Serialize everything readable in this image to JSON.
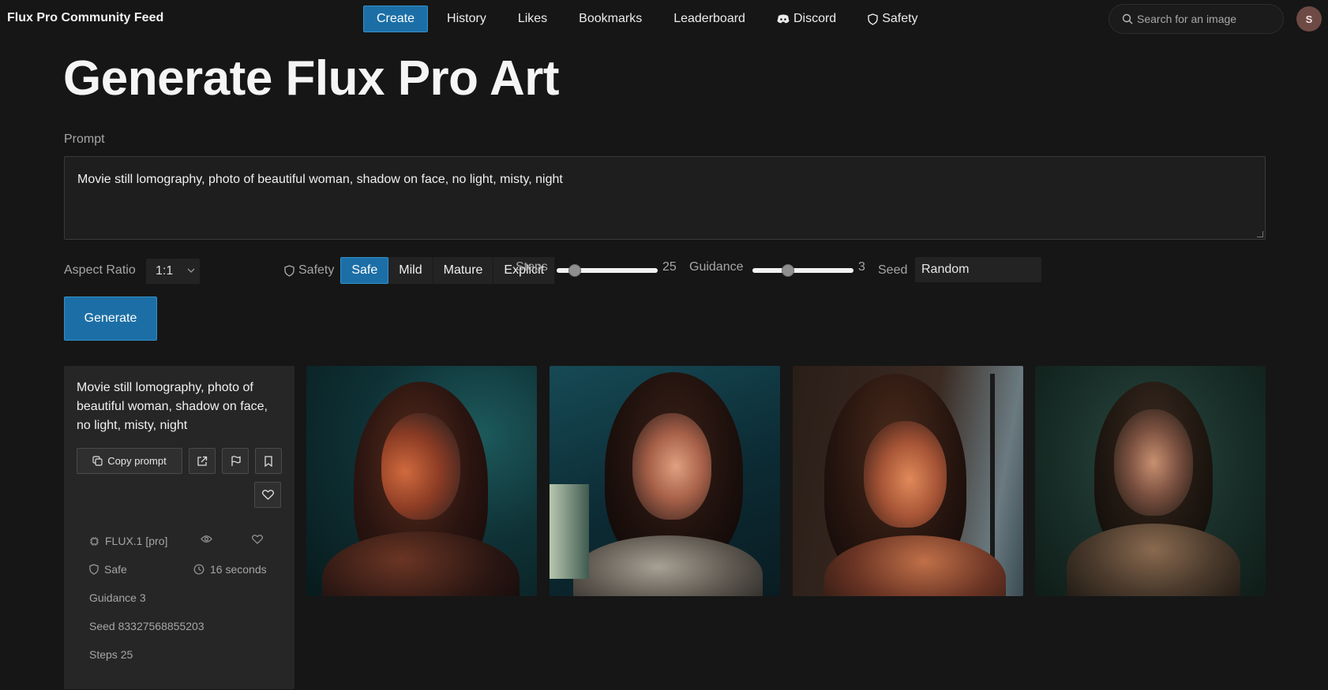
{
  "nav": {
    "brand": "Flux Pro Community Feed",
    "links": [
      {
        "label": "Create",
        "active": true
      },
      {
        "label": "History"
      },
      {
        "label": "Likes"
      },
      {
        "label": "Bookmarks"
      },
      {
        "label": "Leaderboard"
      },
      {
        "label": "Discord",
        "icon": "discord-icon"
      },
      {
        "label": "Safety",
        "icon": "shield-icon"
      }
    ],
    "search_placeholder": "Search for an image",
    "avatar_initial": "S"
  },
  "main": {
    "title": "Generate Flux Pro Art",
    "prompt_label": "Prompt",
    "prompt_value": "Movie still lomography, photo of beautiful woman, shadow on face, no light, misty, night"
  },
  "controls": {
    "aspect_label": "Aspect Ratio",
    "aspect_value": "1:1",
    "safety_label": "Safety",
    "safety_options": [
      "Safe",
      "Mild",
      "Mature",
      "Explicit"
    ],
    "safety_selected": "Safe",
    "steps_label": "Steps",
    "steps_value": "25",
    "guidance_label": "Guidance",
    "guidance_value": "3",
    "seed_label": "Seed",
    "seed_value": "Random",
    "generate_label": "Generate"
  },
  "result": {
    "prompt": "Movie still lomography, photo of beautiful woman, shadow on face, no light, misty, night",
    "copy_label": "Copy prompt",
    "model": "FLUX.1 [pro]",
    "safety": "Safe",
    "duration": "16 seconds",
    "guidance": "Guidance 3",
    "seed": "Seed 83327568855203",
    "steps": "Steps 25"
  },
  "colors": {
    "accent": "#1c6fa6",
    "background": "#161616",
    "card": "#262626"
  }
}
